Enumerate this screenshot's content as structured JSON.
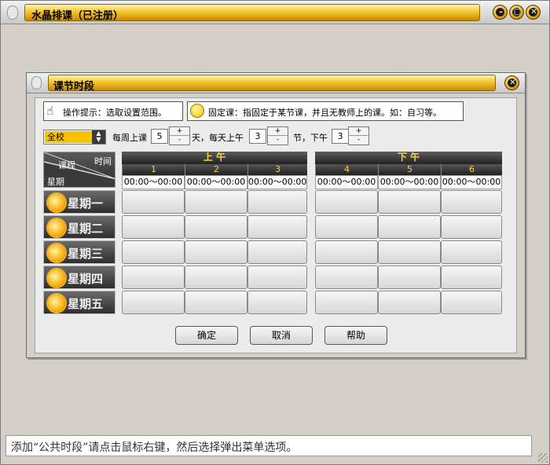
{
  "window": {
    "title": "水晶排课（已注册）",
    "controls": [
      "minimize-icon",
      "maximize-icon",
      "close-icon"
    ]
  },
  "dialog": {
    "title": "课节时段",
    "tip_operation": "操作提示：选取设置范围。",
    "tip_fixed": "固定课：指固定于某节课，并且无教师上的课。如：自习等。",
    "scope_select": "全校",
    "weekly_label": "每周上课",
    "weekly_value": "5",
    "day_label": "天，每天上午",
    "morning_value": "3",
    "lesson_label": "节，下午",
    "afternoon_value": "3",
    "corner": {
      "time": "时间",
      "course": "课程",
      "weekday": "星期"
    },
    "morning_header": "上    午",
    "afternoon_header": "下    午",
    "slots": [
      "1",
      "2",
      "3",
      "4",
      "5",
      "6"
    ],
    "times": [
      "00:00～00:00",
      "00:00～00:00",
      "00:00～00:00",
      "00:00～00:00",
      "00:00～00:00",
      "00:00～00:00"
    ],
    "days": [
      "星期一",
      "星期二",
      "星期三",
      "星期四",
      "星期五"
    ],
    "buttons": {
      "ok": "确定",
      "cancel": "取消",
      "help": "帮助"
    }
  },
  "status_text": "添加“公共时段”请点击鼠标右键，然后选择弹出菜单选项。",
  "colors": {
    "gold": "#f4c430",
    "highlight": "#ffd24a"
  }
}
